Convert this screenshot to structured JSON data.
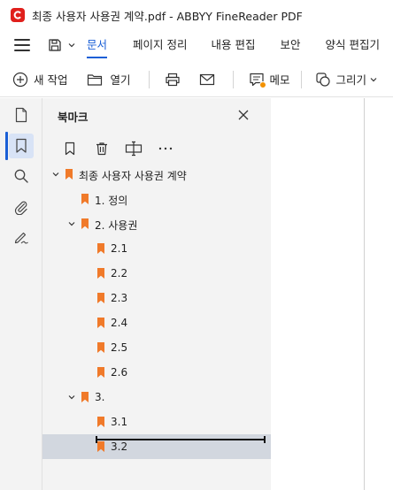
{
  "window": {
    "title": "최종 사용자 사용권 계약.pdf - ABBYY FineReader PDF"
  },
  "menu": {
    "items": [
      "문서",
      "페이지 정리",
      "내용 편집",
      "보안",
      "양식 편집기"
    ],
    "active_index": 0
  },
  "toolbar": {
    "new_task": "새 작업",
    "open": "열기",
    "memo": "메모",
    "draw": "그리기"
  },
  "panel": {
    "title": "북마크"
  },
  "bookmarks": [
    {
      "label": "최종 사용자 사용권 계약",
      "level": 0,
      "expanded": true,
      "selected": false
    },
    {
      "label": "1.  정의",
      "level": 1,
      "expanded": null,
      "selected": false
    },
    {
      "label": "2.  사용권",
      "level": 1,
      "expanded": true,
      "selected": false
    },
    {
      "label": "2.1",
      "level": 2,
      "expanded": null,
      "selected": false
    },
    {
      "label": "2.2",
      "level": 2,
      "expanded": null,
      "selected": false
    },
    {
      "label": "2.3",
      "level": 2,
      "expanded": null,
      "selected": false
    },
    {
      "label": "2.4",
      "level": 2,
      "expanded": null,
      "selected": false
    },
    {
      "label": "2.5",
      "level": 2,
      "expanded": null,
      "selected": false
    },
    {
      "label": "2.6",
      "level": 2,
      "expanded": null,
      "selected": false
    },
    {
      "label": "3.",
      "level": 1,
      "expanded": true,
      "selected": false
    },
    {
      "label": "3.1",
      "level": 2,
      "expanded": null,
      "selected": false
    },
    {
      "label": "3.2",
      "level": 2,
      "expanded": null,
      "selected": true
    }
  ],
  "colors": {
    "accent": "#1a5fd6",
    "bookmark": "#f07a2a",
    "logo": "#e0201c",
    "memo_dot": "#f29100",
    "selected_row": "#d2d7df"
  }
}
